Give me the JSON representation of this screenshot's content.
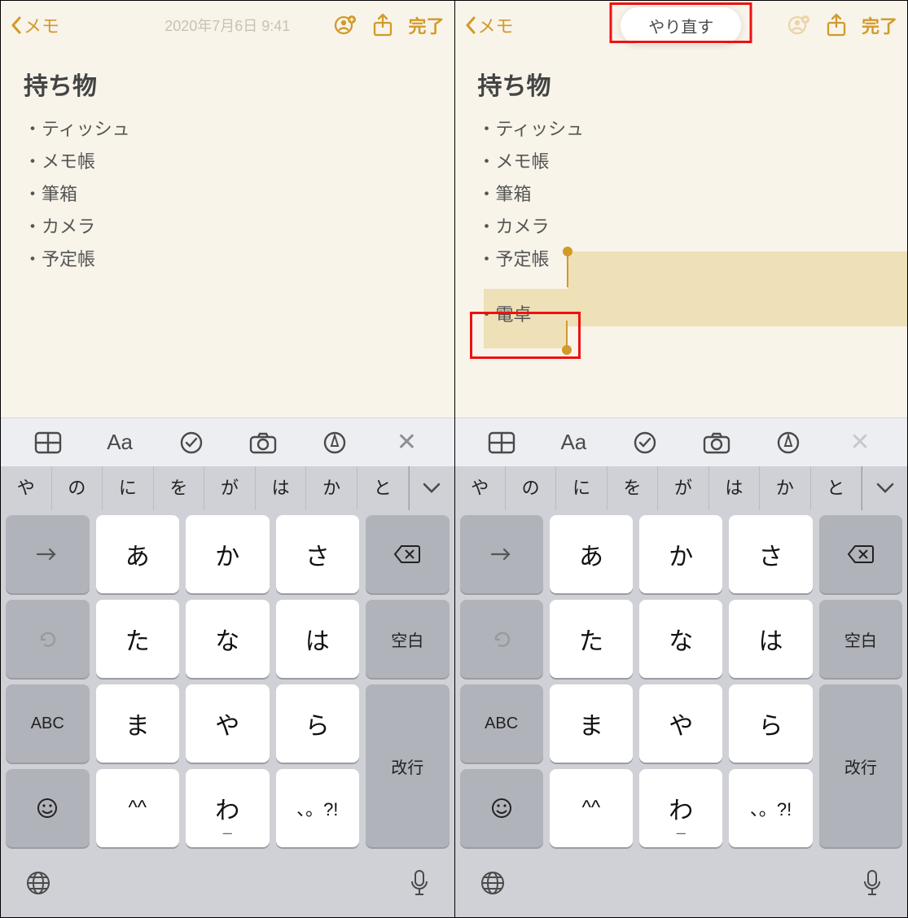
{
  "nav": {
    "back_label": "メモ",
    "done_label": "完了",
    "timestamp": "2020年7月6日 9:41",
    "redo_label": "やり直す"
  },
  "note": {
    "title": "持ち物",
    "items": [
      "・ティッシュ",
      "・メモ帳",
      "・筆箱",
      "・カメラ",
      "・予定帳"
    ],
    "new_item": "・電卓"
  },
  "toolbar": {
    "icons": [
      "table-icon",
      "text-format-icon",
      "checklist-icon",
      "camera-icon",
      "markup-icon",
      "close-icon"
    ]
  },
  "suggestions": [
    "や",
    "の",
    "に",
    "を",
    "が",
    "は",
    "か",
    "と"
  ],
  "keyboard": {
    "rows": [
      [
        "→",
        "あ",
        "か",
        "さ",
        "⌫"
      ],
      [
        "↺",
        "た",
        "な",
        "は",
        "空白"
      ],
      [
        "ABC",
        "ま",
        "や",
        "ら",
        "改行"
      ],
      [
        "☺",
        "^^",
        "わ",
        "、。?!",
        ""
      ]
    ],
    "wa_sub": "ー"
  },
  "colors": {
    "accent": "#d19a2a",
    "highlight": "#eee0b7",
    "annotation": "#e11"
  }
}
